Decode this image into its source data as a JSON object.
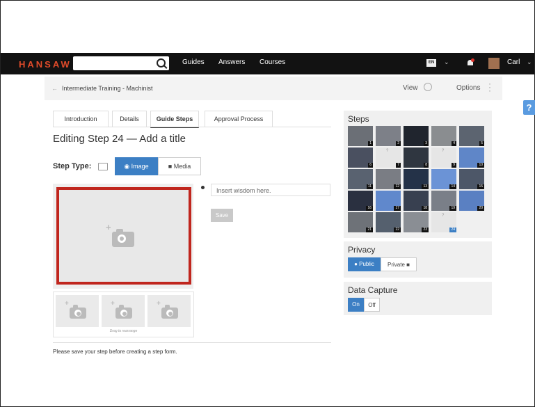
{
  "header": {
    "logo": "HANSAW",
    "nav": [
      "Guides",
      "Answers",
      "Courses"
    ],
    "language": "EN",
    "user_name": "Carl"
  },
  "breadcrumb": {
    "title": "Intermediate Training - Machinist",
    "view_label": "View",
    "options_label": "Options"
  },
  "help_label": "?",
  "tabs": [
    {
      "label": "Introduction"
    },
    {
      "label": "Details"
    },
    {
      "label": "Guide Steps",
      "active": true
    },
    {
      "label": "Approval Process"
    }
  ],
  "editor": {
    "heading": "Editing Step 24 — Add a title",
    "step_type_label": "Step Type:",
    "image_button": "Image",
    "media_button": "Media",
    "drag_hint": "Drag to rearrange",
    "bullet_placeholder": "Insert wisdom here.",
    "save_label": "Save",
    "note": "Please save your step before creating a step form."
  },
  "steps_panel": {
    "title": "Steps",
    "steps": [
      {
        "n": "1",
        "color": "#6b6f76"
      },
      {
        "n": "2",
        "color": "#7d8088"
      },
      {
        "n": "3",
        "color": "#20252e"
      },
      {
        "n": "4",
        "color": "#8a8d90"
      },
      {
        "n": "5",
        "color": "#5c6470"
      },
      {
        "n": "6",
        "color": "#4a5060"
      },
      {
        "n": "7",
        "empty": true
      },
      {
        "n": "8",
        "color": "#2f3640"
      },
      {
        "n": "9",
        "empty": true
      },
      {
        "n": "10",
        "color": "#5f86c8"
      },
      {
        "n": "11",
        "color": "#596270"
      },
      {
        "n": "12",
        "color": "#7a7d84"
      },
      {
        "n": "13",
        "color": "#243248"
      },
      {
        "n": "14",
        "color": "#6b93d6"
      },
      {
        "n": "15",
        "color": "#4d5768"
      },
      {
        "n": "16",
        "color": "#2a3040"
      },
      {
        "n": "17",
        "color": "#6088cc"
      },
      {
        "n": "18",
        "color": "#384050"
      },
      {
        "n": "19",
        "color": "#7a7f88"
      },
      {
        "n": "20",
        "color": "#5a80c2"
      },
      {
        "n": "21",
        "color": "#6e7278"
      },
      {
        "n": "22",
        "color": "#55606e"
      },
      {
        "n": "23",
        "color": "#8a8e94"
      },
      {
        "n": "24",
        "empty": true,
        "current": true
      }
    ]
  },
  "privacy": {
    "title": "Privacy",
    "public_label": "Public",
    "private_label": "Private"
  },
  "data_capture": {
    "title": "Data Capture",
    "on_label": "On",
    "off_label": "Off"
  }
}
